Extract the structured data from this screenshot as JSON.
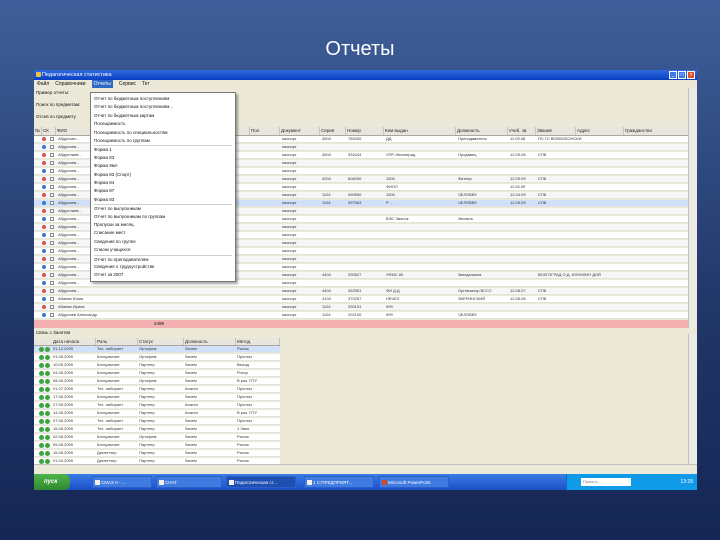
{
  "slide": {
    "title": "Отчеты"
  },
  "window": {
    "title": "Педагогическая статистика"
  },
  "menu": [
    "Файл",
    "Справочники",
    "Отчеты",
    "Сервис",
    "Тег"
  ],
  "left_panel": [
    "Пример отчеты:",
    "Поиск по предметам:",
    "Отсев по предмету"
  ],
  "columns": [
    "№",
    "СК",
    "ФИО",
    "Дата рожд.",
    "Пол",
    "Документ",
    "Серия",
    "Номер",
    "Кем выдан",
    "Должность",
    "Учеб. зв.",
    "Звание",
    "Адрес",
    "Гражданство"
  ],
  "dropdown": [
    "Отчет по бюджетным поступлениям",
    "Отчет по бюджетным поступлениям...",
    "Отчет по бюджетным картам",
    "Посещаемость",
    "Посещаемость по специальностям",
    "Посещаемость по группам",
    "Форма 1",
    "Форма 83",
    "Форма 9мл",
    "Форма 83 (Спорт)",
    "Форма 84",
    "Форма 87",
    "Форма 83",
    "Отчет по выпускникам",
    "Отчет по выпускникам по группам",
    "Пропуски за месяц",
    "Списание мест",
    "Сведения по группе",
    "Списки учащихся",
    "Отчет по преподавателям",
    "Сведения о трудоустройстве",
    "Отчет за 2007"
  ],
  "rows": [
    {
      "name": "Абдулхан...",
      "doc": "паспорт",
      "ser": "4504",
      "num": "765430",
      "issued": "ДД",
      "post": "Преподаватель",
      "d": "11.09.08",
      "place": "ПС ГС ВОЕВОЛОНСКИ",
      "color": "#d9534f"
    },
    {
      "name": "Абдулаев...",
      "doc": "паспорт",
      "ser": "",
      "num": "",
      "issued": "",
      "post": "",
      "d": "",
      "place": "",
      "color": "#3a77d8"
    },
    {
      "name": "Абдуллаев...",
      "doc": "паспорт",
      "ser": "4504",
      "num": "932044",
      "issued": "УПР-Ленинград",
      "post": "Продавец",
      "d": "12.09.08",
      "place": "СПБ",
      "color": "#d9534f"
    },
    {
      "name": "Абдулаев...",
      "doc": "паспорт",
      "ser": "",
      "num": "",
      "issued": "",
      "post": "",
      "d": "",
      "place": "",
      "color": "#d9534f"
    },
    {
      "name": "Абдулаев...",
      "doc": "паспорт",
      "ser": "",
      "num": "",
      "issued": "",
      "post": "",
      "d": "",
      "place": "",
      "color": "#3a77d8"
    },
    {
      "name": "Абдулаев...",
      "doc": "паспорт",
      "ser": "4004",
      "num": "606290",
      "issued": "1500",
      "post": "Фитнер",
      "d": "12.09.09",
      "place": "СПБ",
      "color": "#d9534f"
    },
    {
      "name": "Абдулаев...",
      "doc": "паспорт",
      "ser": "",
      "num": "",
      "issued": "ФИОЛ",
      "post": "",
      "d": "11.04.09",
      "place": "",
      "color": "#3a77d8"
    },
    {
      "name": "Абдулаев...",
      "doc": "паспорт",
      "ser": "1104",
      "num": "090550",
      "issued": "1500",
      "post": "ЧЕЛОВЕК",
      "d": "12.04.09",
      "place": "СПБ",
      "color": "#d9534f"
    },
    {
      "name": "Абдулаев...",
      "doc": "паспорт",
      "ser": "1104",
      "num": "097563",
      "issued": "Р ...",
      "post": "ЧЕЛОВЕК",
      "d": "12.05.09",
      "place": "СПБ",
      "color": "#3a77d8",
      "sel": true
    },
    {
      "name": "Абдуллаев...",
      "doc": "паспорт",
      "ser": "",
      "num": "",
      "issued": "",
      "post": "",
      "d": "",
      "place": "",
      "color": "#d9534f"
    },
    {
      "name": "Абдулаев...",
      "doc": "паспорт",
      "ser": "",
      "num": "",
      "issued": "ВЭС Звонок",
      "post": "Звонить",
      "d": "",
      "place": "",
      "color": "#3a77d8"
    },
    {
      "name": "Абдулаев...",
      "doc": "паспорт",
      "ser": "",
      "num": "",
      "issued": "",
      "post": "",
      "d": "",
      "place": "",
      "color": "#d9534f"
    },
    {
      "name": "Абдулаев...",
      "doc": "паспорт",
      "ser": "",
      "num": "",
      "issued": "",
      "post": "",
      "d": "",
      "place": "",
      "color": "#3a77d8"
    },
    {
      "name": "Абдулаев...",
      "doc": "паспорт",
      "ser": "",
      "num": "",
      "issued": "",
      "post": "",
      "d": "",
      "place": "",
      "color": "#d9534f"
    },
    {
      "name": "Абдулаев...",
      "doc": "паспорт",
      "ser": "",
      "num": "",
      "issued": "",
      "post": "",
      "d": "",
      "place": "",
      "color": "#3a77d8"
    },
    {
      "name": "Абдулаев...",
      "doc": "паспорт",
      "ser": "",
      "num": "",
      "issued": "",
      "post": "",
      "d": "",
      "place": "",
      "color": "#d9534f"
    },
    {
      "name": "Абдулаев...",
      "doc": "паспорт",
      "ser": "",
      "num": "",
      "issued": "",
      "post": "",
      "d": "",
      "place": "",
      "color": "#3a77d8"
    },
    {
      "name": "Абдулаев...",
      "doc": "паспорт",
      "ser": "4404",
      "num": "290527",
      "issued": "УФМС 80",
      "post": "Звездочкина",
      "d": "",
      "place": "ВОЛГОГРАД О.Д. ИЗУМЛИН ДОЙ",
      "color": "#d9534f"
    },
    {
      "name": "Абдулаев...",
      "doc": "паспорт",
      "ser": "",
      "num": "",
      "issued": "",
      "post": "",
      "d": "",
      "place": "",
      "color": "#3a77d8"
    },
    {
      "name": "Абдулаев...",
      "doc": "паспорт",
      "ser": "4404",
      "num": "262551",
      "issued": "ФИ Д.Д.",
      "post": "Оргнизатор ВССС",
      "d": "12.08.07",
      "place": "СПБ",
      "color": "#d9534f"
    },
    {
      "name": "Абаева Юлия",
      "doc": "паспорт",
      "ser": "4104",
      "num": "370257",
      "issued": "НЕЧЕЗ",
      "post": "ЗВЕРИНСКИЙ",
      "d": "12.06.08",
      "place": "СПБ",
      "color": "#3a77d8"
    },
    {
      "name": "Абаева Ирина",
      "doc": "паспорт",
      "ser": "1104",
      "num": "290151",
      "issued": "999",
      "post": "",
      "d": "",
      "place": "",
      "color": "#d9534f"
    },
    {
      "name": "Абдулаев Александр",
      "doc": "паспорт",
      "ser": "1104",
      "num": "202100",
      "issued": "999",
      "post": "ЧЕЛОВЕК",
      "d": "",
      "place": "",
      "color": "#3a77d8"
    }
  ],
  "summary_value": "2499",
  "lower": {
    "label": "Связь с Занятия",
    "columns": [
      "Дата начала",
      "Роль",
      "Статус",
      "Должность",
      "Метод"
    ],
    "rows": [
      [
        "01.12.2009",
        "Тех. лаборант",
        "Ортофем",
        "Зачем",
        "Рынок"
      ],
      [
        "01.05.2009",
        "Консультант",
        "Ортофем",
        "Зачем",
        "Прогноз"
      ],
      [
        "10.05.2009",
        "Консультант",
        "Партнер",
        "Зачем",
        "Выход"
      ],
      [
        "04.05.2009",
        "Консультант",
        "Партнер",
        "Зачем",
        "Ротор"
      ],
      [
        "08.06.2009",
        "Консультант",
        "Ортофем",
        "Зачем",
        "В раз. ПТУ"
      ],
      [
        "01.07.2009",
        "Тех. лаборант",
        "Партнер",
        "Аналог",
        "Прогноз"
      ],
      [
        "17.06.2009",
        "Консультант",
        "Партнер",
        "Зачем",
        "Прогноз"
      ],
      [
        "27.05.2009",
        "Тех. лаборант",
        "Партнер",
        "Аналог",
        "Прогноз"
      ],
      [
        "14.05.2009",
        "Консультант",
        "Партнер",
        "Аналог",
        "В раз. ПТУ"
      ],
      [
        "07.06.2009",
        "Тех. лаборант",
        "Партнер",
        "Зачем",
        "Прогноз"
      ],
      [
        "15.06.2009",
        "Тех. лаборант",
        "Партнер",
        "Зачем",
        "1 Звон."
      ],
      [
        "02.06.2009",
        "Консультант",
        "Ортофем",
        "Зачем",
        "Рынок"
      ],
      [
        "05.06.2009",
        "Консультант",
        "Партнер",
        "Зачем",
        "Рынок"
      ],
      [
        "15.06.2009",
        "Диспетчер",
        "Партнер",
        "Зачем",
        "Рынок"
      ],
      [
        "01.04.2009",
        "Диспетчер",
        "Партнер",
        "Зачем",
        "Рынок"
      ]
    ]
  },
  "taskbar": {
    "start": "пуск",
    "items": [
      "CMAX 0 - ...",
      "CHAT",
      "Педагогическая ст...",
      "1 С:ПРЕДПРИЯТ...",
      "Microsoft PowerPoint"
    ],
    "search_placeholder": "Поиск в ...",
    "clock": "13:28"
  }
}
